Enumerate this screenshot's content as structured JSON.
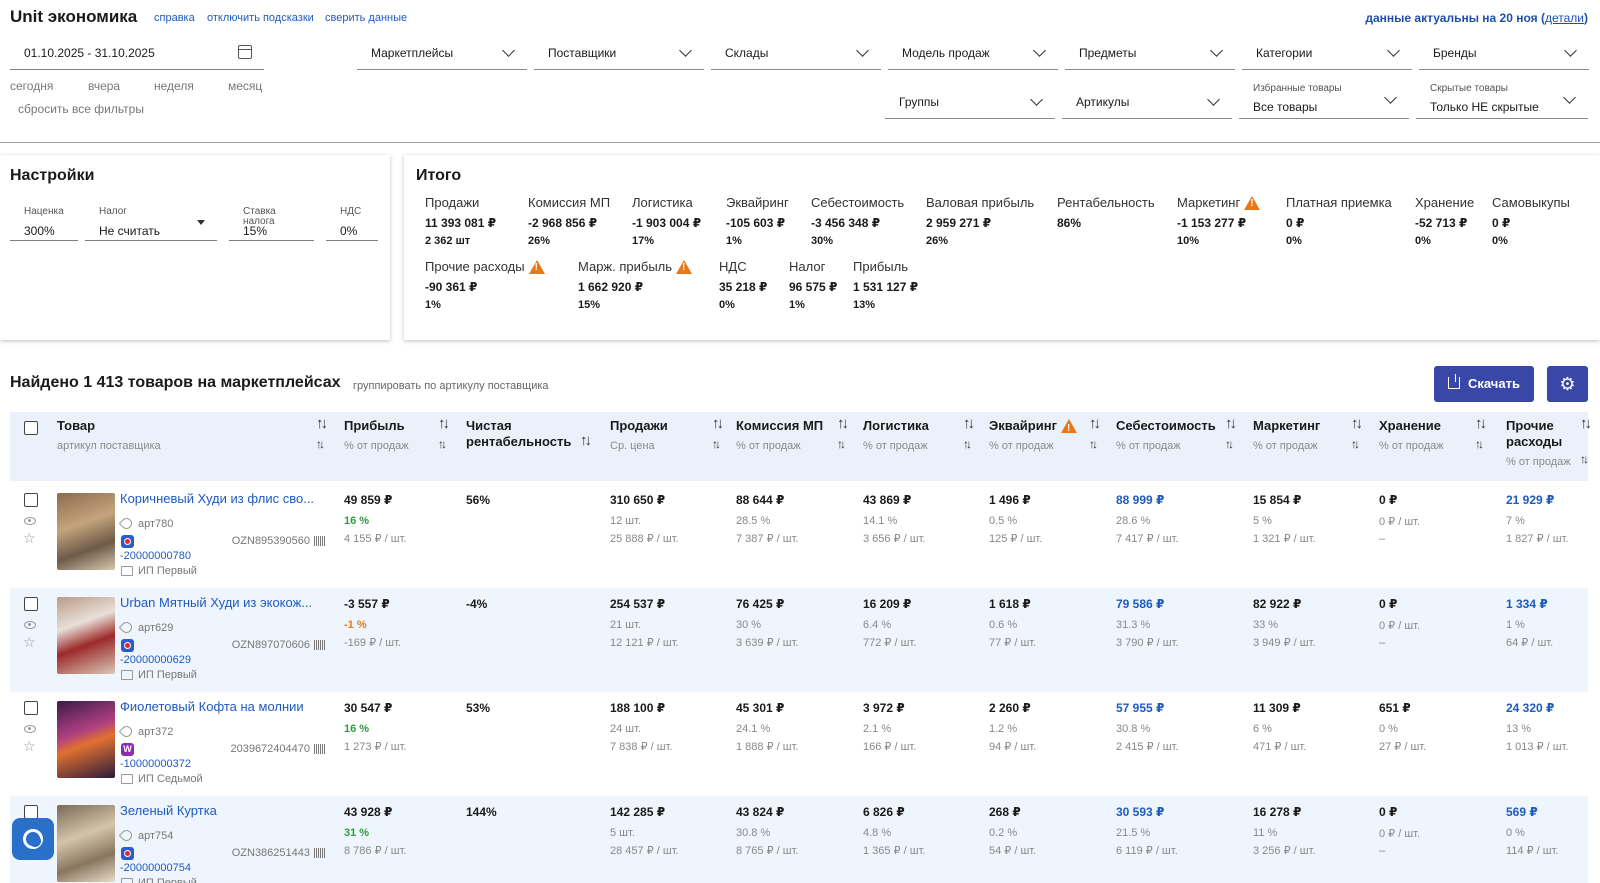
{
  "header": {
    "title": "Unit экономика",
    "links": [
      "справка",
      "отключить подсказки",
      "сверить данные"
    ],
    "actual_prefix": "данные актуальны на 20 ноя (",
    "actual_link": "детали",
    "actual_suffix": ")"
  },
  "date_range": "01.10.2025 - 31.10.2025",
  "quick_ranges": [
    "сегодня",
    "вчера",
    "неделя",
    "месяц"
  ],
  "reset_filters": "сбросить все фильтры",
  "filters_row1": [
    "Маркетплейсы",
    "Поставщики",
    "Склады",
    "Модель продаж",
    "Предметы",
    "Категории",
    "Бренды"
  ],
  "filters_row2": {
    "groups": "Группы",
    "articles": "Артикулы",
    "favorites_caption": "Избранные товары",
    "favorites_value": "Все товары",
    "hidden_caption": "Скрытые товары",
    "hidden_value": "Только НЕ скрытые"
  },
  "settings": {
    "title": "Настройки",
    "markup_caption": "Наценка",
    "markup_value": "300%",
    "tax_caption": "Налог",
    "tax_value": "Не считать",
    "rate_caption": "Ставка налога",
    "rate_value": "15%",
    "vat_caption": "НДС",
    "vat_value": "0%"
  },
  "totals": {
    "title": "Итого",
    "metrics": [
      {
        "label": "Продажи",
        "value": "11 393 081 ₽",
        "sub": "2 362 шт"
      },
      {
        "label": "Комиссия МП",
        "value": "-2 968 856 ₽",
        "sub": "26%"
      },
      {
        "label": "Логистика",
        "value": "-1 903 004 ₽",
        "sub": "17%"
      },
      {
        "label": "Эквайринг",
        "value": "-105 603 ₽",
        "sub": "1%"
      },
      {
        "label": "Себестоимость",
        "value": "-3 456 348 ₽",
        "sub": "30%"
      },
      {
        "label": "Валовая прибыль",
        "value": "2 959 271 ₽",
        "sub": "26%"
      },
      {
        "label": "Рентабельность",
        "value": "86%",
        "sub": ""
      },
      {
        "label": "Маркетинг",
        "value": "-1 153 277 ₽",
        "sub": "10%",
        "warn": true
      },
      {
        "label": "Платная приемка",
        "value": "0 ₽",
        "sub": "0%"
      },
      {
        "label": "Хранение",
        "value": "-52 713 ₽",
        "sub": "0%"
      },
      {
        "label": "Самовыкупы",
        "value": "0 ₽",
        "sub": "0%"
      },
      {
        "label": "Прочие расходы",
        "value": "-90 361 ₽",
        "sub": "1%",
        "warn": true
      },
      {
        "label": "Марж. прибыль",
        "value": "1 662 920 ₽",
        "sub": "15%",
        "warn": true
      },
      {
        "label": "НДС",
        "value": "35 218 ₽",
        "sub": "0%"
      },
      {
        "label": "Налог",
        "value": "96 575 ₽",
        "sub": "1%"
      },
      {
        "label": "Прибыль",
        "value": "1 531 127 ₽",
        "sub": "13%"
      }
    ]
  },
  "found": {
    "text": "Найдено 1 413 товаров на маркетплейсах",
    "group_link": "группировать по артикулу поставщика",
    "download": "Скачать"
  },
  "columns": [
    {
      "h1": "Товар",
      "h2": "артикул поставщика"
    },
    {
      "h1": "Прибыль",
      "h2": "% от продаж"
    },
    {
      "h1": "Чистая рентабельность",
      "h2": ""
    },
    {
      "h1": "Продажи",
      "h2": "Ср. цена"
    },
    {
      "h1": "Комиссия МП",
      "h2": "% от продаж"
    },
    {
      "h1": "Логистика",
      "h2": "% от продаж"
    },
    {
      "h1": "Эквайринг",
      "h2": "% от продаж",
      "warn": true
    },
    {
      "h1": "Себестоимость",
      "h2": "% от продаж"
    },
    {
      "h1": "Маркетинг",
      "h2": "% от продаж"
    },
    {
      "h1": "Хранение",
      "h2": "% от продаж"
    },
    {
      "h1": "Прочие расходы",
      "h2": "% от продаж"
    }
  ],
  "rows": [
    {
      "name": "Коричневый Худи из флис сво...",
      "art": "арт780",
      "mp": "oz",
      "sku": "-20000000780",
      "ozn": "OZN895390560",
      "seller": "ИП Первый",
      "profit": [
        "49 859 ₽",
        "16 %",
        "4 155 ₽ / шт."
      ],
      "net": "56%",
      "sales": [
        "310 650 ₽",
        "12 шт.",
        "25 888 ₽ / шт."
      ],
      "commission": [
        "88 644 ₽",
        "28.5 %",
        "7 387 ₽ / шт."
      ],
      "logistics": [
        "43 869 ₽",
        "14.1 %",
        "3 656 ₽ / шт."
      ],
      "acquiring": [
        "1 496 ₽",
        "0.5 %",
        "125 ₽ / шт."
      ],
      "cost": [
        "88 999 ₽",
        "28.6 %",
        "7 417 ₽ / шт."
      ],
      "marketing": [
        "15 854 ₽",
        "5 %",
        "1 321 ₽ / шт."
      ],
      "storage": [
        "0 ₽",
        "0 ₽ / шт.",
        "–"
      ],
      "other": [
        "21 929 ₽",
        "7 %",
        "1 827 ₽ / шт."
      ]
    },
    {
      "name": "Urban Мятный Худи из экокож...",
      "art": "арт629",
      "mp": "oz",
      "sku": "-20000000629",
      "ozn": "OZN897070606",
      "seller": "ИП Первый",
      "profit": [
        "-3 557 ₽",
        "-1 %",
        "-169 ₽ / шт."
      ],
      "net": "-4%",
      "sales": [
        "254 537 ₽",
        "21 шт.",
        "12 121 ₽ / шт."
      ],
      "commission": [
        "76 425 ₽",
        "30 %",
        "3 639 ₽ / шт."
      ],
      "logistics": [
        "16 209 ₽",
        "6.4 %",
        "772 ₽ / шт."
      ],
      "acquiring": [
        "1 618 ₽",
        "0.6 %",
        "77 ₽ / шт."
      ],
      "cost": [
        "79 586 ₽",
        "31.3 %",
        "3 790 ₽ / шт."
      ],
      "marketing": [
        "82 922 ₽",
        "33 %",
        "3 949 ₽ / шт."
      ],
      "storage": [
        "0 ₽",
        "0 ₽ / шт.",
        "–"
      ],
      "other": [
        "1 334 ₽",
        "1 %",
        "64 ₽ / шт."
      ]
    },
    {
      "name": "Фиолетовый Кофта на молнии",
      "art": "арт372",
      "mp": "wb",
      "sku": "-10000000372",
      "ozn": "2039672404470",
      "seller": "ИП Седьмой",
      "profit": [
        "30 547 ₽",
        "16 %",
        "1 273 ₽ / шт."
      ],
      "net": "53%",
      "sales": [
        "188 100 ₽",
        "24 шт.",
        "7 838 ₽ / шт."
      ],
      "commission": [
        "45 301 ₽",
        "24.1 %",
        "1 888 ₽ / шт."
      ],
      "logistics": [
        "3 972 ₽",
        "2.1 %",
        "166 ₽ / шт."
      ],
      "acquiring": [
        "2 260 ₽",
        "1.2 %",
        "94 ₽ / шт."
      ],
      "cost": [
        "57 955 ₽",
        "30.8 %",
        "2 415 ₽ / шт."
      ],
      "marketing": [
        "11 309 ₽",
        "6 %",
        "471 ₽ / шт."
      ],
      "storage": [
        "651 ₽",
        "0 %",
        "27 ₽ / шт."
      ],
      "other": [
        "24 320 ₽",
        "13 %",
        "1 013 ₽ / шт."
      ]
    },
    {
      "name": "Зеленый Куртка",
      "art": "арт754",
      "mp": "oz",
      "sku": "-20000000754",
      "ozn": "OZN386251443",
      "seller": "ИП Первый",
      "profit": [
        "43 928 ₽",
        "31 %",
        "8 786 ₽ / шт."
      ],
      "net": "144%",
      "sales": [
        "142 285 ₽",
        "5 шт.",
        "28 457 ₽ / шт."
      ],
      "commission": [
        "43 824 ₽",
        "30.8 %",
        "8 765 ₽ / шт."
      ],
      "logistics": [
        "6 826 ₽",
        "4.8 %",
        "1 365 ₽ / шт."
      ],
      "acquiring": [
        "268 ₽",
        "0.2 %",
        "54 ₽ / шт."
      ],
      "cost": [
        "30 593 ₽",
        "21.5 %",
        "6 119 ₽ / шт."
      ],
      "marketing": [
        "16 278 ₽",
        "11 %",
        "3 256 ₽ / шт."
      ],
      "storage": [
        "0 ₽",
        "0 ₽ / шт.",
        "–"
      ],
      "other": [
        "569 ₽",
        "0 %",
        "114 ₽ / шт."
      ]
    }
  ],
  "colors": {
    "link": "#1e5bbf",
    "button": "#3847a8",
    "positive": "#2e9e3e",
    "negative": "#e07b1a",
    "warning": "#e8771a",
    "header_bg": "#eaf1fa"
  }
}
